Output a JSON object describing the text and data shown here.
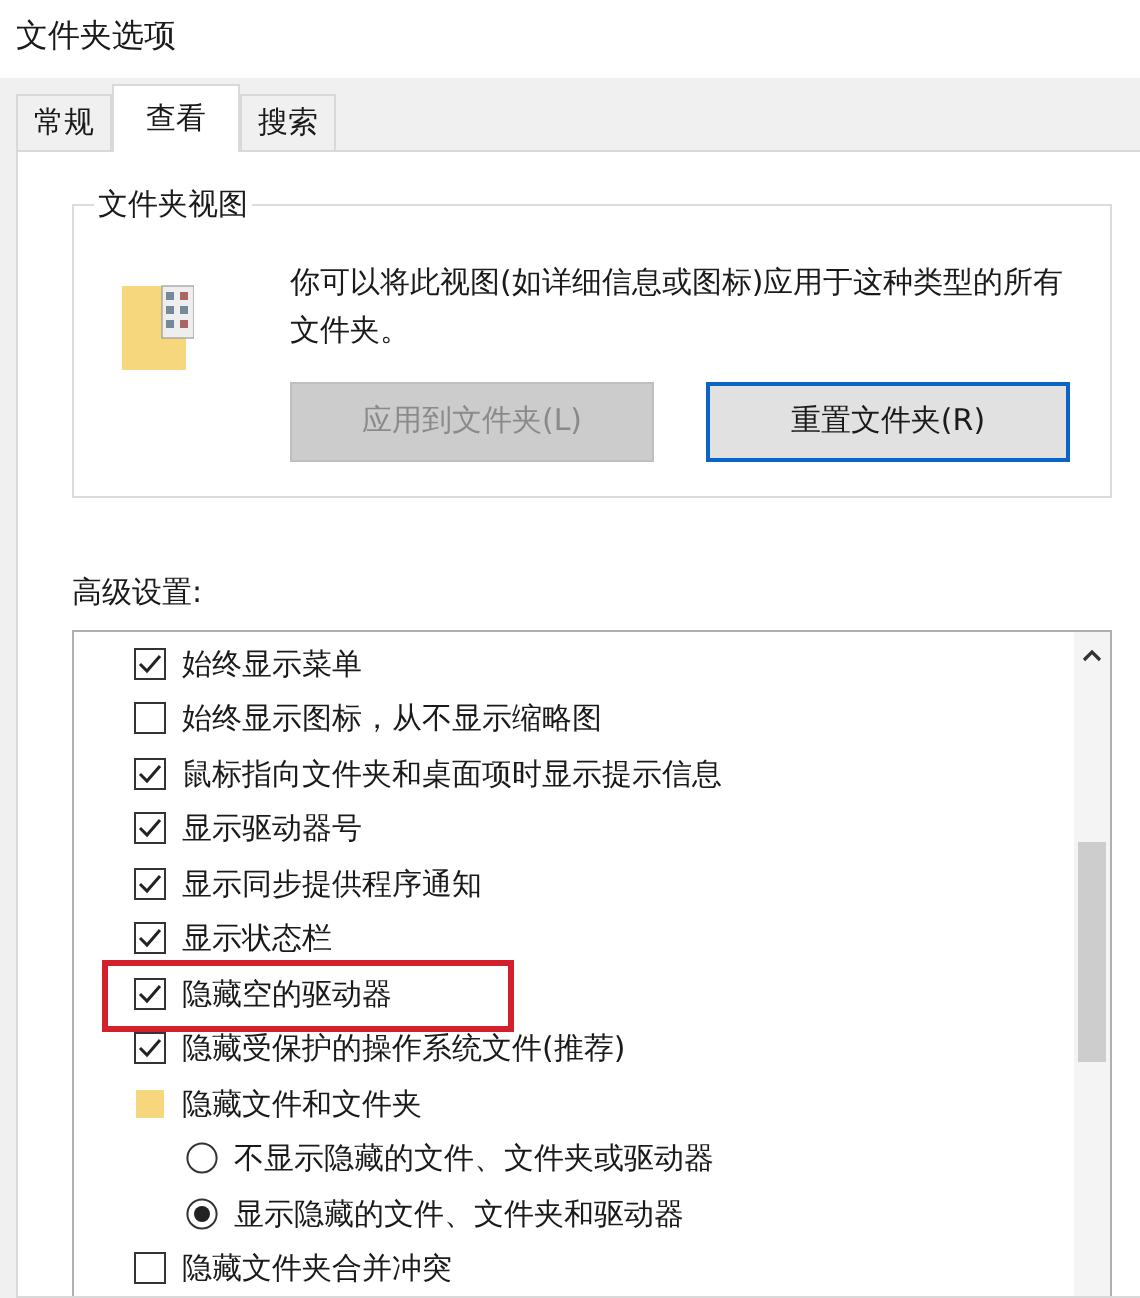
{
  "window": {
    "title": "文件夹选项"
  },
  "tabs": [
    {
      "label": "常规",
      "selected": false
    },
    {
      "label": "查看",
      "selected": true
    },
    {
      "label": "搜索",
      "selected": false
    }
  ],
  "folder_views": {
    "title": "文件夹视图",
    "description": "你可以将此视图(如详细信息或图标)应用于这种类型的所有文件夹。",
    "buttons": [
      {
        "label": "应用到文件夹(L)",
        "disabled": true
      },
      {
        "label": "重置文件夹(R)",
        "disabled": false
      }
    ]
  },
  "advanced": {
    "label": "高级设置:",
    "items": [
      {
        "kind": "checkbox",
        "label": "始终显示菜单",
        "checked": true,
        "highlighted": false
      },
      {
        "kind": "checkbox",
        "label": "始终显示图标，从不显示缩略图",
        "checked": false,
        "highlighted": false
      },
      {
        "kind": "checkbox",
        "label": "鼠标指向文件夹和桌面项时显示提示信息",
        "checked": true,
        "highlighted": false
      },
      {
        "kind": "checkbox",
        "label": "显示驱动器号",
        "checked": true,
        "highlighted": false
      },
      {
        "kind": "checkbox",
        "label": "显示同步提供程序通知",
        "checked": true,
        "highlighted": false
      },
      {
        "kind": "checkbox",
        "label": "显示状态栏",
        "checked": true,
        "highlighted": false
      },
      {
        "kind": "checkbox",
        "label": "隐藏空的驱动器",
        "checked": true,
        "highlighted": true
      },
      {
        "kind": "checkbox",
        "label": "隐藏受保护的操作系统文件(推荐)",
        "checked": true,
        "highlighted": false
      },
      {
        "kind": "folder",
        "label": "隐藏文件和文件夹",
        "highlighted": false
      },
      {
        "kind": "radio",
        "label": "不显示隐藏的文件、文件夹或驱动器",
        "selected": false,
        "highlighted": false
      },
      {
        "kind": "radio",
        "label": "显示隐藏的文件、文件夹和驱动器",
        "selected": true,
        "highlighted": false
      },
      {
        "kind": "checkbox",
        "label": "隐藏文件夹合并冲突",
        "checked": false,
        "highlighted": false
      }
    ]
  }
}
